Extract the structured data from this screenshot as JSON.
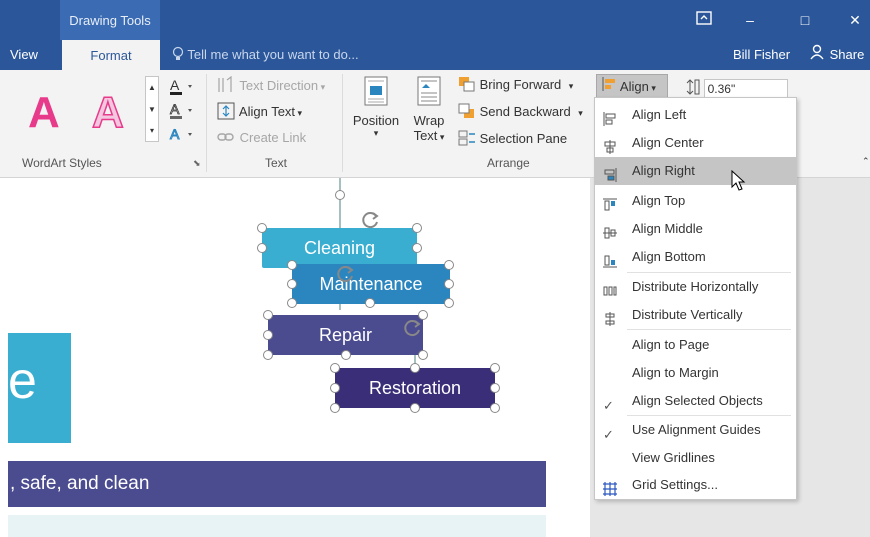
{
  "titlebar": {
    "context_tab": "Drawing Tools",
    "minimize": "–",
    "maximize": "□",
    "close": "✕"
  },
  "tabs": {
    "view": "View",
    "format": "Format",
    "tellme": "Tell me what you want to do...",
    "user": "Bill Fisher",
    "share": "Share"
  },
  "ribbon": {
    "wordart_label": "WordArt Styles",
    "text_label": "Text",
    "arrange_label": "Arrange",
    "text_direction": "Text Direction",
    "align_text": "Align Text",
    "create_link": "Create Link",
    "position": "Position",
    "wrap_line1": "Wrap",
    "wrap_line2": "Text",
    "bring_forward": "Bring Forward",
    "send_backward": "Send Backward",
    "selection_pane": "Selection Pane",
    "align_button": "Align",
    "height_value": "0.36\"",
    "wordart_letter": "A"
  },
  "doc": {
    "shapes": [
      "Cleaning",
      "Maintenance",
      "Repair",
      "Restoration"
    ],
    "banner_text": ", safe, and clean",
    "big_letter": "e"
  },
  "menu": {
    "items": [
      {
        "label": "Align Left",
        "icon": "align-left-icon"
      },
      {
        "label": "Align Center",
        "icon": "align-center-icon"
      },
      {
        "label": "Align Right",
        "icon": "align-right-icon"
      },
      {
        "label": "Align Top",
        "icon": "align-top-icon"
      },
      {
        "label": "Align Middle",
        "icon": "align-middle-icon"
      },
      {
        "label": "Align Bottom",
        "icon": "align-bottom-icon"
      },
      {
        "label": "Distribute Horizontally",
        "icon": "distribute-horizontally-icon"
      },
      {
        "label": "Distribute Vertically",
        "icon": "distribute-vertically-icon"
      },
      {
        "label": "Align to Page",
        "icon": ""
      },
      {
        "label": "Align to Margin",
        "icon": ""
      },
      {
        "label": "Align Selected Objects",
        "icon": "checkmark-icon"
      },
      {
        "label": "Use Alignment Guides",
        "icon": "checkmark-icon"
      },
      {
        "label": "View Gridlines",
        "icon": ""
      },
      {
        "label": "Grid Settings...",
        "icon": "grid-icon"
      }
    ],
    "hovered": "Align Right"
  },
  "colors": {
    "word_blue": "#2b579a",
    "shape_cleaning": "#3aaed0",
    "shape_maintenance": "#2b86bf",
    "shape_repair": "#4b4b8f",
    "shape_restoration": "#3a2e78",
    "banner": "#4b4b8f",
    "teal_block": "#3aaed0",
    "wordart_pink": "#e83a8a"
  }
}
